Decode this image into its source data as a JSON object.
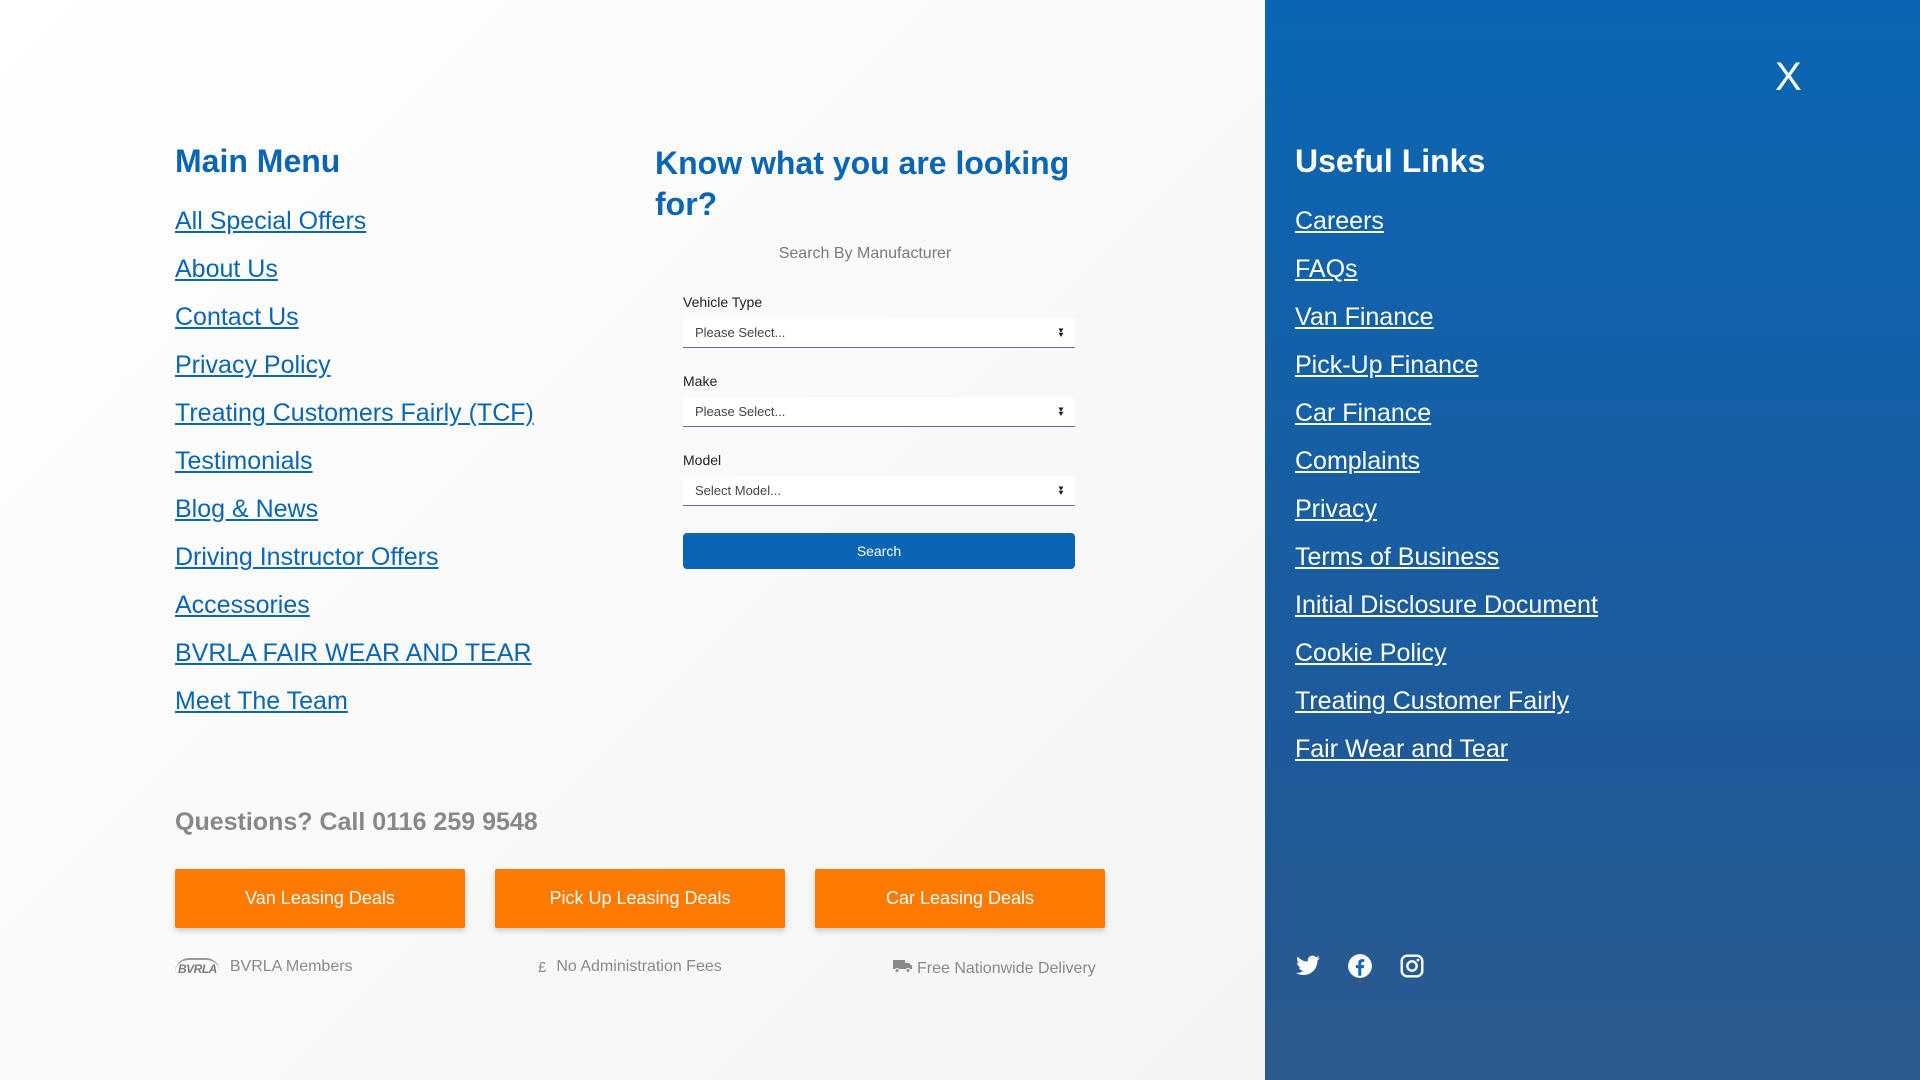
{
  "main_menu": {
    "title": "Main Menu",
    "items": [
      "All Special Offers",
      "About Us",
      "Contact Us",
      "Privacy Policy",
      "Treating Customers Fairly (TCF)",
      "Testimonials",
      "Blog & News",
      "Driving Instructor Offers",
      "Accessories",
      "BVRLA FAIR WEAR AND TEAR",
      "Meet The Team"
    ]
  },
  "search": {
    "title": "Know what you are looking for?",
    "subtitle": "Search By Manufacturer",
    "vehicle_type_label": "Vehicle Type",
    "vehicle_type_value": "Please Select...",
    "make_label": "Make",
    "make_value": "Please Select...",
    "model_label": "Model",
    "model_value": "Select Model...",
    "button_label": "Search"
  },
  "questions": "Questions? Call 0116 259 9548",
  "deals": [
    "Van Leasing Deals",
    "Pick Up Leasing Deals",
    "Car Leasing Deals"
  ],
  "features": {
    "bvrla_logo_text": "BVRLA",
    "bvrla": "BVRLA Members",
    "fees_symbol": "£",
    "fees": "No Administration Fees",
    "delivery": "Free Nationwide Delivery"
  },
  "close_label": "X",
  "useful_links": {
    "title": "Useful Links",
    "items": [
      "Careers",
      "FAQs",
      "Van Finance",
      "Pick-Up Finance",
      "Car Finance",
      "Complaints",
      "Privacy",
      "Terms of Business",
      "Initial Disclosure Document",
      "Cookie Policy",
      "Treating Customer Fairly",
      "Fair Wear and Tear"
    ]
  },
  "social_icons": [
    "twitter-icon",
    "facebook-icon",
    "instagram-icon"
  ],
  "colors": {
    "primary_blue": "#0a66b4",
    "orange": "#ff7a00"
  }
}
